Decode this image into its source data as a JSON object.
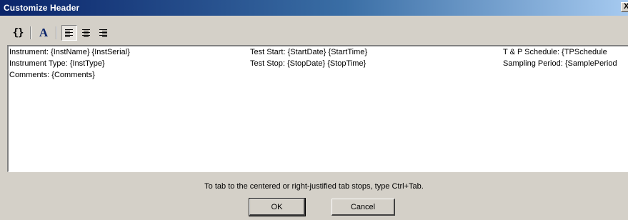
{
  "window": {
    "title": "Customize Header",
    "close_glyph": "X"
  },
  "toolbar": {
    "buttons": [
      {
        "name": "insert-field",
        "glyph": "{}",
        "icon": "braces-icon"
      },
      {
        "name": "font",
        "glyph": "A",
        "icon": "font-icon"
      },
      {
        "name": "align-left",
        "icon": "align-left-icon",
        "pressed": true
      },
      {
        "name": "align-center",
        "icon": "align-center-icon",
        "pressed": false
      },
      {
        "name": "align-right",
        "icon": "align-right-icon",
        "pressed": false
      }
    ]
  },
  "editor": {
    "lines": [
      {
        "left": "Instrument: {InstName} {InstSerial}",
        "center": "Test Start: {StartDate} {StartTime}",
        "right": "T & P Schedule: {TPSchedule"
      },
      {
        "left": "Instrument Type: {InstType}",
        "center": "Test Stop: {StopDate} {StopTime}",
        "right": "Sampling Period: {SamplePeriod"
      },
      {
        "left": "Comments: {Comments}",
        "center": "",
        "right": ""
      }
    ]
  },
  "footer": {
    "hint": "To tab to the centered or right-justified tab stops, type Ctrl+Tab.",
    "ok_label": "OK",
    "cancel_label": "Cancel"
  },
  "colors": {
    "title_bar_start": "#0a246a",
    "title_bar_end": "#a6caf0",
    "dialog_face": "#d4d0c8",
    "editor_bg": "#ffffff"
  }
}
